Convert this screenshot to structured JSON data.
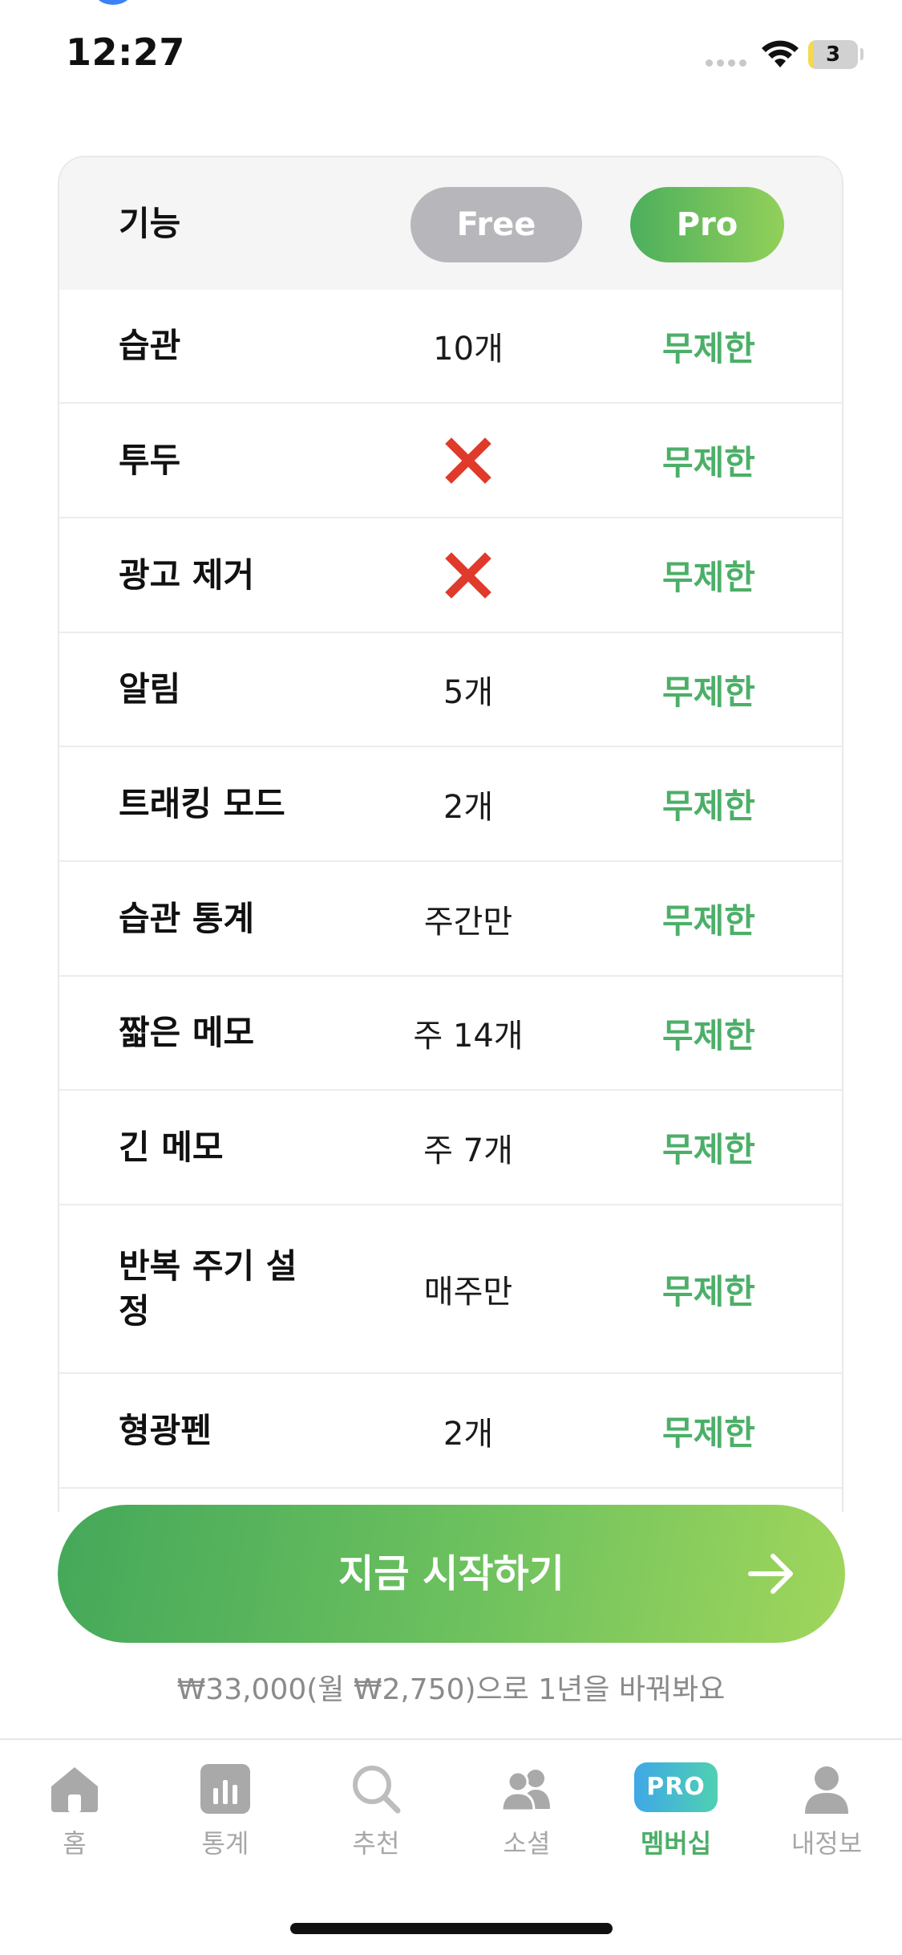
{
  "status_bar": {
    "time": "12:27",
    "battery": "3",
    "battery_level": 0.1
  },
  "table": {
    "header": {
      "feature": "기능",
      "free": "Free",
      "pro": "Pro"
    },
    "rows": [
      {
        "feature": "습관",
        "free": "10개",
        "free_icon": "",
        "pro": "무제한"
      },
      {
        "feature": "투두",
        "free": "",
        "free_icon": "cross-mark-icon",
        "pro": "무제한"
      },
      {
        "feature": "광고 제거",
        "free": "",
        "free_icon": "cross-mark-icon",
        "pro": "무제한"
      },
      {
        "feature": "알림",
        "free": "5개",
        "free_icon": "",
        "pro": "무제한"
      },
      {
        "feature": "트래킹 모드",
        "free": "2개",
        "free_icon": "",
        "pro": "무제한"
      },
      {
        "feature": "습관 통계",
        "free": "주간만",
        "free_icon": "",
        "pro": "무제한"
      },
      {
        "feature": "짧은 메모",
        "free": "주 14개",
        "free_icon": "",
        "pro": "무제한"
      },
      {
        "feature": "긴 메모",
        "free": "주 7개",
        "free_icon": "",
        "pro": "무제한"
      },
      {
        "feature": "반복 주기 설정",
        "free": "매주만",
        "free_icon": "",
        "pro": "무제한"
      },
      {
        "feature": "형광펜",
        "free": "2개",
        "free_icon": "",
        "pro": "무제한"
      }
    ]
  },
  "cta": {
    "label": "지금 시작하기",
    "icon": "arrow-right-icon"
  },
  "price_note": "₩33,000(월 ₩2,750)으로 1년을 바꿔봐요",
  "tab_bar": {
    "items": [
      {
        "label": "홈",
        "icon": "home-icon"
      },
      {
        "label": "통계",
        "icon": "chart-icon"
      },
      {
        "label": "추천",
        "icon": "search-icon"
      },
      {
        "label": "소셜",
        "icon": "people-icon"
      },
      {
        "label": "멤버십",
        "icon": "pro-badge-icon",
        "badge": "PRO",
        "active": true
      },
      {
        "label": "내정보",
        "icon": "person-icon"
      }
    ]
  },
  "colors": {
    "accent_green": "#4caf68",
    "free_pill": "#b7b7bb",
    "cross": "#e03a2b"
  }
}
